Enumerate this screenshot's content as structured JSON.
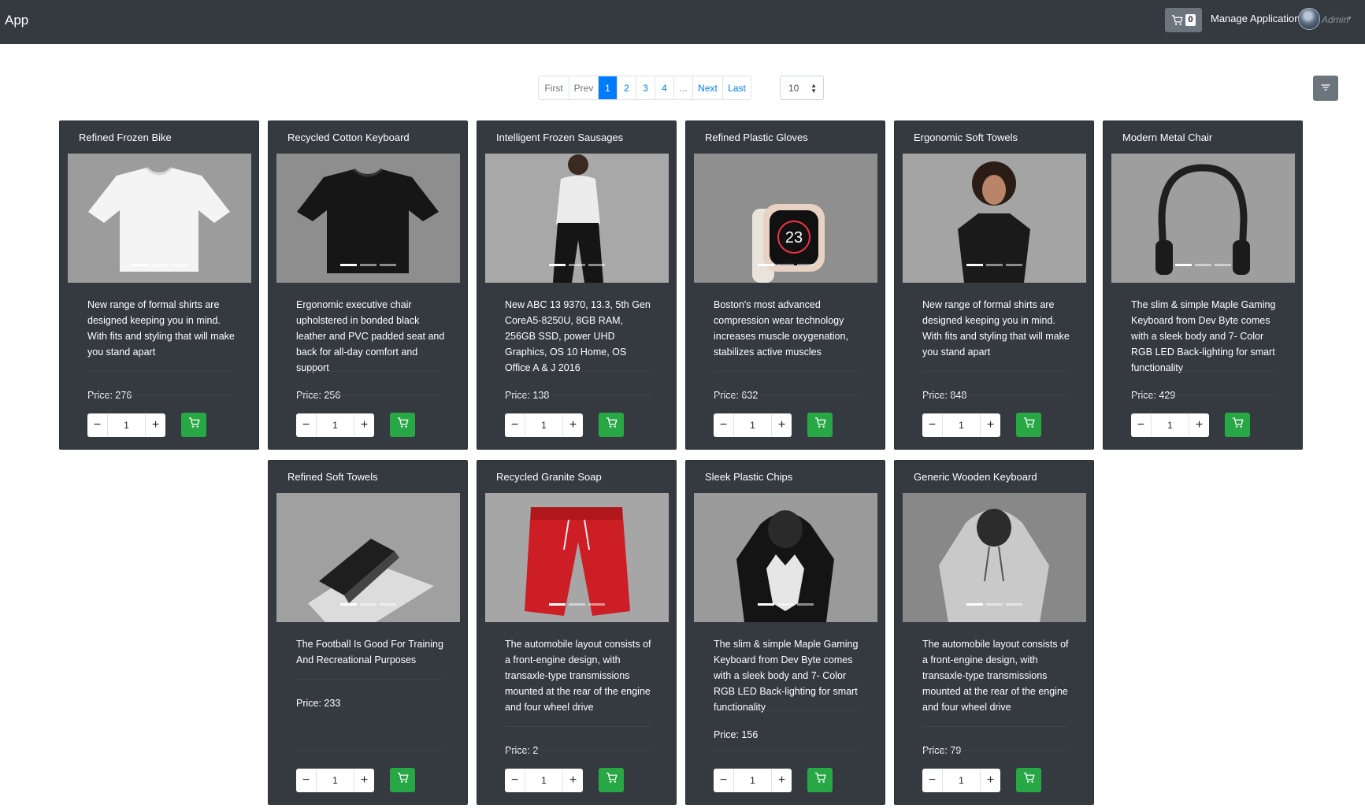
{
  "app": {
    "brand": "App"
  },
  "navbar": {
    "cart_count": "0",
    "manage_label": "Manage Application",
    "user_label": "Admin"
  },
  "pagination": {
    "first": "First",
    "prev": "Prev",
    "pages": [
      "1",
      "2",
      "3",
      "4"
    ],
    "active_page": "1",
    "ellipsis": "...",
    "next": "Next",
    "last": "Last",
    "page_size": "10"
  },
  "products": [
    {
      "title": "Refined Frozen Bike",
      "description": "New range of formal shirts are designed keeping you in mind. With fits and styling that will make you stand apart",
      "price": "Price: 276",
      "quantity": "1",
      "image": "white-tshirt"
    },
    {
      "title": "Recycled Cotton Keyboard",
      "description": "Ergonomic executive chair upholstered in bonded black leather and PVC padded seat and back for all-day comfort and support",
      "price": "Price: 256",
      "quantity": "1",
      "image": "black-tshirt"
    },
    {
      "title": "Intelligent Frozen Sausages",
      "description": "New ABC 13 9370, 13.3, 5th Gen CoreA5-8250U, 8GB RAM, 256GB SSD, power UHD Graphics, OS 10 Home, OS Office A & J 2016",
      "price": "Price: 138",
      "quantity": "1",
      "image": "woman-sweater"
    },
    {
      "title": "Refined Plastic Gloves",
      "description": "Boston's most advanced compression wear technology increases muscle oxygenation, stabilizes active muscles",
      "price": "Price: 632",
      "quantity": "1",
      "image": "smartwatch"
    },
    {
      "title": "Ergonomic Soft Towels",
      "description": "New range of formal shirts are designed keeping you in mind. With fits and styling that will make you stand apart",
      "price": "Price: 848",
      "quantity": "1",
      "image": "woman-tshirt"
    },
    {
      "title": "Modern Metal Chair",
      "description": "The slim & simple Maple Gaming Keyboard from Dev Byte comes with a sleek body and 7- Color RGB LED Back-lighting for smart functionality",
      "price": "Price: 429",
      "quantity": "1",
      "image": "headphones"
    },
    {
      "title": "Refined Soft Towels",
      "description": "The Football Is Good For Training And Recreational Purposes",
      "price": "Price: 233",
      "quantity": "1",
      "image": "phone"
    },
    {
      "title": "Recycled Granite Soap",
      "description": "The automobile layout consists of a front-engine design, with transaxle-type transmissions mounted at the rear of the engine and four wheel drive",
      "price": "Price: 2",
      "quantity": "1",
      "image": "red-pants"
    },
    {
      "title": "Sleek Plastic Chips",
      "description": "The slim & simple Maple Gaming Keyboard from Dev Byte comes with a sleek body and 7- Color RGB LED Back-lighting for smart functionality",
      "price": "Price: 156",
      "quantity": "1",
      "image": "wolf-hoodie"
    },
    {
      "title": "Generic Wooden Keyboard",
      "description": "The automobile layout consists of a front-engine design, with transaxle-type transmissions mounted at the rear of the engine and four wheel drive",
      "price": "Price: 79",
      "quantity": "1",
      "image": "grey-hoodie"
    }
  ],
  "colors": {
    "navbar": "#343a40",
    "card": "#343a40",
    "primary": "#007bff",
    "success": "#28a745",
    "secondary": "#6c757d"
  }
}
